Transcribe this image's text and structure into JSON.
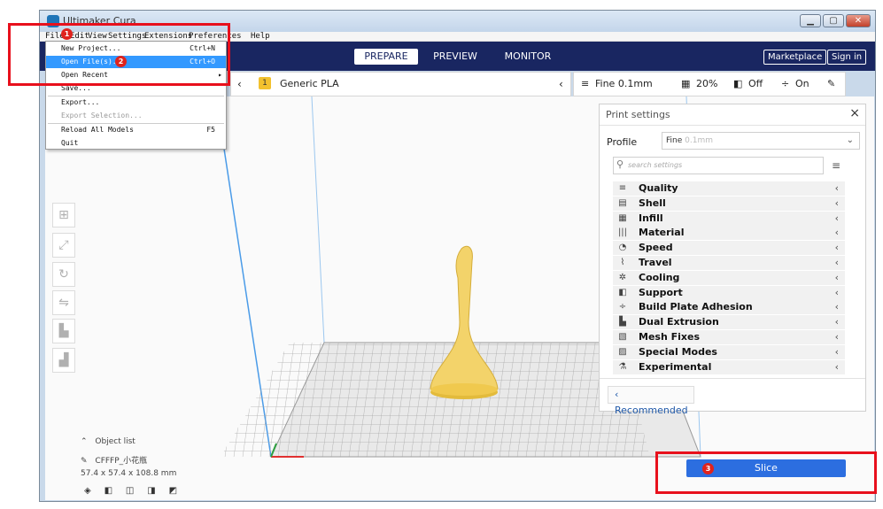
{
  "window": {
    "title": "Ultimaker Cura",
    "controls": [
      "minimize",
      "maximize",
      "close"
    ]
  },
  "menubar": {
    "items": [
      "File",
      "Edit",
      "View",
      "Settings",
      "Extensions",
      "Preferences",
      "Help"
    ]
  },
  "file_menu": {
    "items": [
      {
        "label": "New Project...",
        "shortcut": "Ctrl+N",
        "state": "normal"
      },
      {
        "label": "Open File(s)...",
        "shortcut": "Ctrl+O",
        "state": "highlighted"
      },
      {
        "label": "Open Recent",
        "shortcut": "▸",
        "state": "normal"
      },
      {
        "label": "Save...",
        "shortcut": "",
        "state": "normal"
      },
      {
        "label": "Export...",
        "shortcut": "",
        "state": "normal"
      },
      {
        "label": "Export Selection...",
        "shortcut": "",
        "state": "disabled"
      },
      {
        "label": "Reload All Models",
        "shortcut": "F5",
        "state": "normal"
      },
      {
        "label": "Quit",
        "shortcut": "",
        "state": "normal"
      }
    ]
  },
  "header": {
    "tabs": [
      "PREPARE",
      "PREVIEW",
      "MONITOR"
    ],
    "active_tab": "PREPARE",
    "marketplace_label": "Marketplace",
    "signin_label": "Sign in"
  },
  "material_bar": {
    "badge": "1",
    "material": "Generic PLA"
  },
  "print_bar": {
    "quality": "Fine 0.1mm",
    "infill": "20%",
    "support": "Off",
    "adhesion": "On"
  },
  "print_settings": {
    "title": "Print settings",
    "profile_label": "Profile",
    "profile_value": "Fine",
    "profile_hint": "0.1mm",
    "search_placeholder": "search settings",
    "categories": [
      {
        "label": "Quality",
        "icon": "≡"
      },
      {
        "label": "Shell",
        "icon": "▤"
      },
      {
        "label": "Infill",
        "icon": "▦"
      },
      {
        "label": "Material",
        "icon": "|||"
      },
      {
        "label": "Speed",
        "icon": "◔"
      },
      {
        "label": "Travel",
        "icon": "⌇"
      },
      {
        "label": "Cooling",
        "icon": "✲"
      },
      {
        "label": "Support",
        "icon": "◧"
      },
      {
        "label": "Build Plate Adhesion",
        "icon": "÷"
      },
      {
        "label": "Dual Extrusion",
        "icon": "▙"
      },
      {
        "label": "Mesh Fixes",
        "icon": "▧"
      },
      {
        "label": "Special Modes",
        "icon": "▨"
      },
      {
        "label": "Experimental",
        "icon": "⚗"
      }
    ],
    "recommended_label": "Recommended"
  },
  "objects": {
    "list_label": "Object list",
    "model_name": "CFFFP_小花瓶",
    "dimensions": "57.4 x 57.4 x 108.8 mm"
  },
  "slice": {
    "label": "Slice"
  },
  "annotations": [
    "1",
    "2",
    "3"
  ],
  "colors": {
    "header_bg": "#192661",
    "accent_blue": "#2c6ee0",
    "annotation_red": "#e8101c",
    "model_yellow": "#f3d36a",
    "menu_highlight": "#3399ff"
  }
}
